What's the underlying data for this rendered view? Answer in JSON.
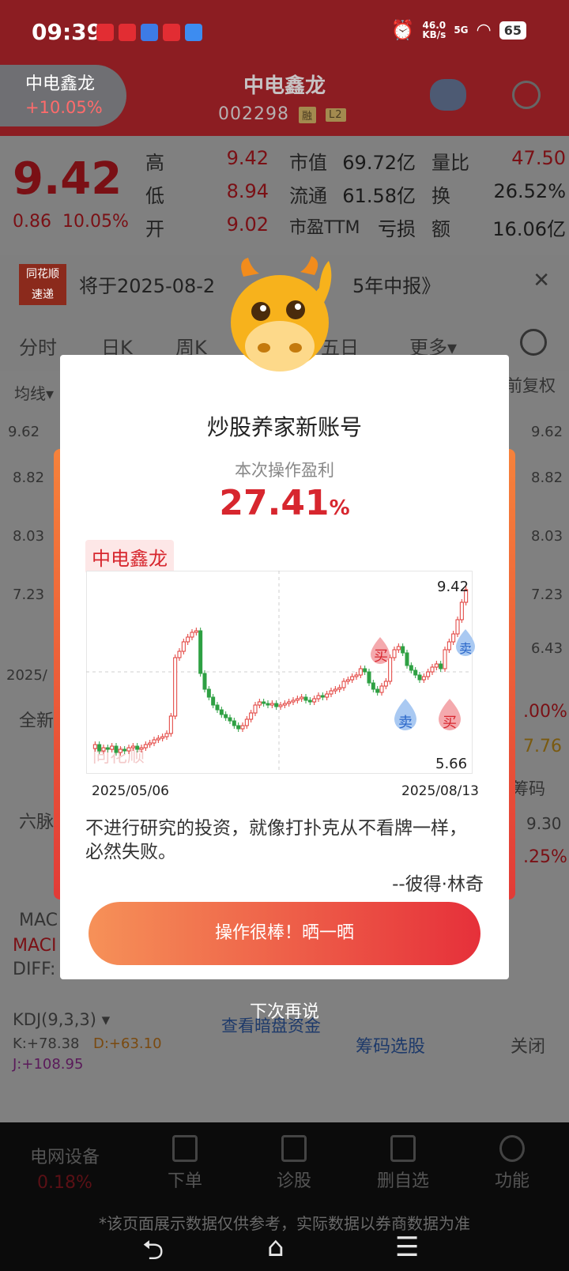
{
  "status_bar": {
    "time": "09:39",
    "net_speed_value": "46.0",
    "net_speed_unit": "KB/s",
    "signal": "5G",
    "battery": "65"
  },
  "header": {
    "pill_name": "中电鑫龙",
    "pill_change": "+10.05%",
    "title": "中电鑫龙",
    "code": "002298",
    "badge_rong": "融",
    "badge_l2": "L2"
  },
  "quote": {
    "price": "9.42",
    "change": "0.86",
    "change_pct": "10.05%",
    "rows": [
      {
        "l1": "高",
        "v1": "9.42",
        "l2": "市值",
        "v2": "69.72亿",
        "l3": "量比",
        "v3": "47.50"
      },
      {
        "l1": "低",
        "v1": "8.94",
        "l2": "流通",
        "v2": "61.58亿",
        "l3": "换",
        "v3": "26.52%"
      },
      {
        "l1": "开",
        "v1": "9.02",
        "l2": "市盈TTM",
        "v2": "亏损",
        "l3": "额",
        "v3": "16.06亿"
      }
    ]
  },
  "news": {
    "logo_top": "同花顺",
    "logo_bottom": "速递",
    "text": "将于2025-08-2",
    "text_tail": "5年中报》"
  },
  "tabs": [
    "分时",
    "日K",
    "周K",
    "五日",
    "更多▾"
  ],
  "chart_bg": {
    "indicator": "均线▾",
    "adjust": "前复权",
    "ticks": [
      "9.62",
      "8.82",
      "8.03",
      "7.23",
      "6.43"
    ],
    "date_partial": "2025/",
    "quanxin": "全新",
    "liumai": "六脉",
    "macd": "MAC",
    "macd2": "MACI",
    "diff": "DIFF:",
    "kdj": "KDJ(9,3,3) ▾",
    "k": "K:+78.38",
    "d": "D:+63.10",
    "j": "J:+108.95",
    "anpan": "查看暗盘资金",
    "right_pct": ".00%",
    "right_val": "7.76",
    "right_chip": "筹码",
    "right_930": "9.30",
    "right_pct2": ".25%",
    "chip_select": "筹码选股",
    "close": "关闭"
  },
  "bottom_nav": {
    "sector": "电网设备",
    "sector_chg": "0.18%",
    "items": [
      "下单",
      "诊股",
      "删自选",
      "功能"
    ],
    "disclaimer": "*该页面展示数据仅供参考，实际数据以券商数据为准"
  },
  "modal": {
    "title": "炒股养家新账号",
    "subtitle": "本次操作盈利",
    "profit_value": "27.41",
    "profit_unit": "%",
    "stock_name": "中电鑫龙",
    "chart_high": "9.42",
    "chart_low": "5.66",
    "date_start": "2025/05/06",
    "date_end": "2025/08/13",
    "watermark": "同花顺",
    "buy_label": "买",
    "sell_label": "卖",
    "quote": "不进行研究的投资，就像打扑克从不看牌一样，必然失败。",
    "author": "--彼得·林奇",
    "share_button": "操作很棒！晒一晒",
    "later_link": "下次再说"
  },
  "colors": {
    "brand_red": "#d7262e",
    "header_bg": "#8c1d22",
    "candle_up": "#e23b37",
    "candle_down": "#2ea043"
  }
}
